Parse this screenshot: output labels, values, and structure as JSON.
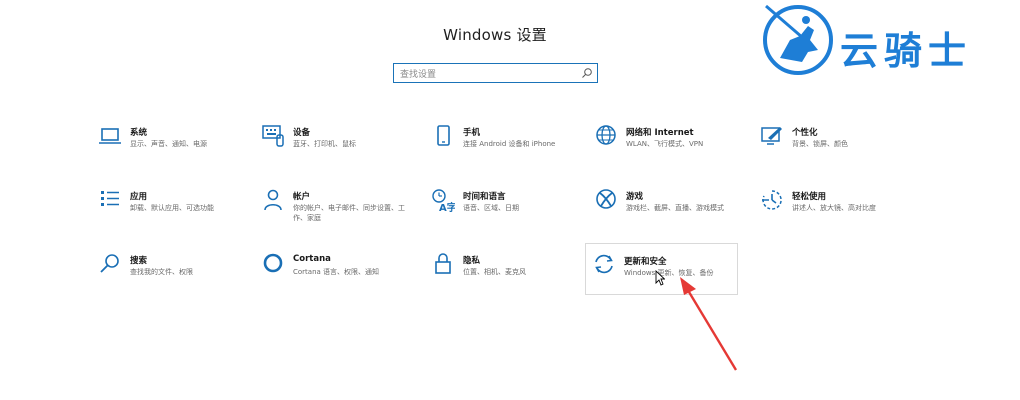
{
  "window": {
    "title": "Windows 设置"
  },
  "search": {
    "placeholder": "查找设置"
  },
  "watermark": {
    "text": "云骑士"
  },
  "accent": "#1a73b8",
  "tiles": [
    {
      "name": "系统",
      "desc": "显示、声音、通知、电源",
      "icon": "laptop-icon"
    },
    {
      "name": "设备",
      "desc": "蓝牙、打印机、鼠标",
      "icon": "keyboard-icon"
    },
    {
      "name": "手机",
      "desc": "连接 Android 设备和 iPhone",
      "icon": "phone-icon"
    },
    {
      "name": "网络和 Internet",
      "desc": "WLAN、飞行模式、VPN",
      "icon": "globe-icon"
    },
    {
      "name": "个性化",
      "desc": "背景、锁屏、颜色",
      "icon": "brush-icon"
    },
    {
      "name": "应用",
      "desc": "卸载、默认应用、可选功能",
      "icon": "apps-list-icon"
    },
    {
      "name": "帐户",
      "desc": "你的帐户、电子邮件、同步设置、工作、家庭",
      "icon": "person-icon"
    },
    {
      "name": "时间和语言",
      "desc": "语音、区域、日期",
      "icon": "time-language-icon"
    },
    {
      "name": "游戏",
      "desc": "游戏栏、截屏、直播、游戏模式",
      "icon": "xbox-icon"
    },
    {
      "name": "轻松使用",
      "desc": "讲述人、放大镜、高对比度",
      "icon": "accessibility-icon"
    },
    {
      "name": "搜索",
      "desc": "查找我的文件、权限",
      "icon": "search-icon"
    },
    {
      "name": "Cortana",
      "desc": "Cortana 语言、权限、通知",
      "icon": "cortana-icon"
    },
    {
      "name": "隐私",
      "desc": "位置、相机、麦克风",
      "icon": "lock-icon"
    },
    {
      "name": "更新和安全",
      "desc": "Windows 更新、恢复、备份",
      "icon": "update-sync-icon"
    }
  ]
}
